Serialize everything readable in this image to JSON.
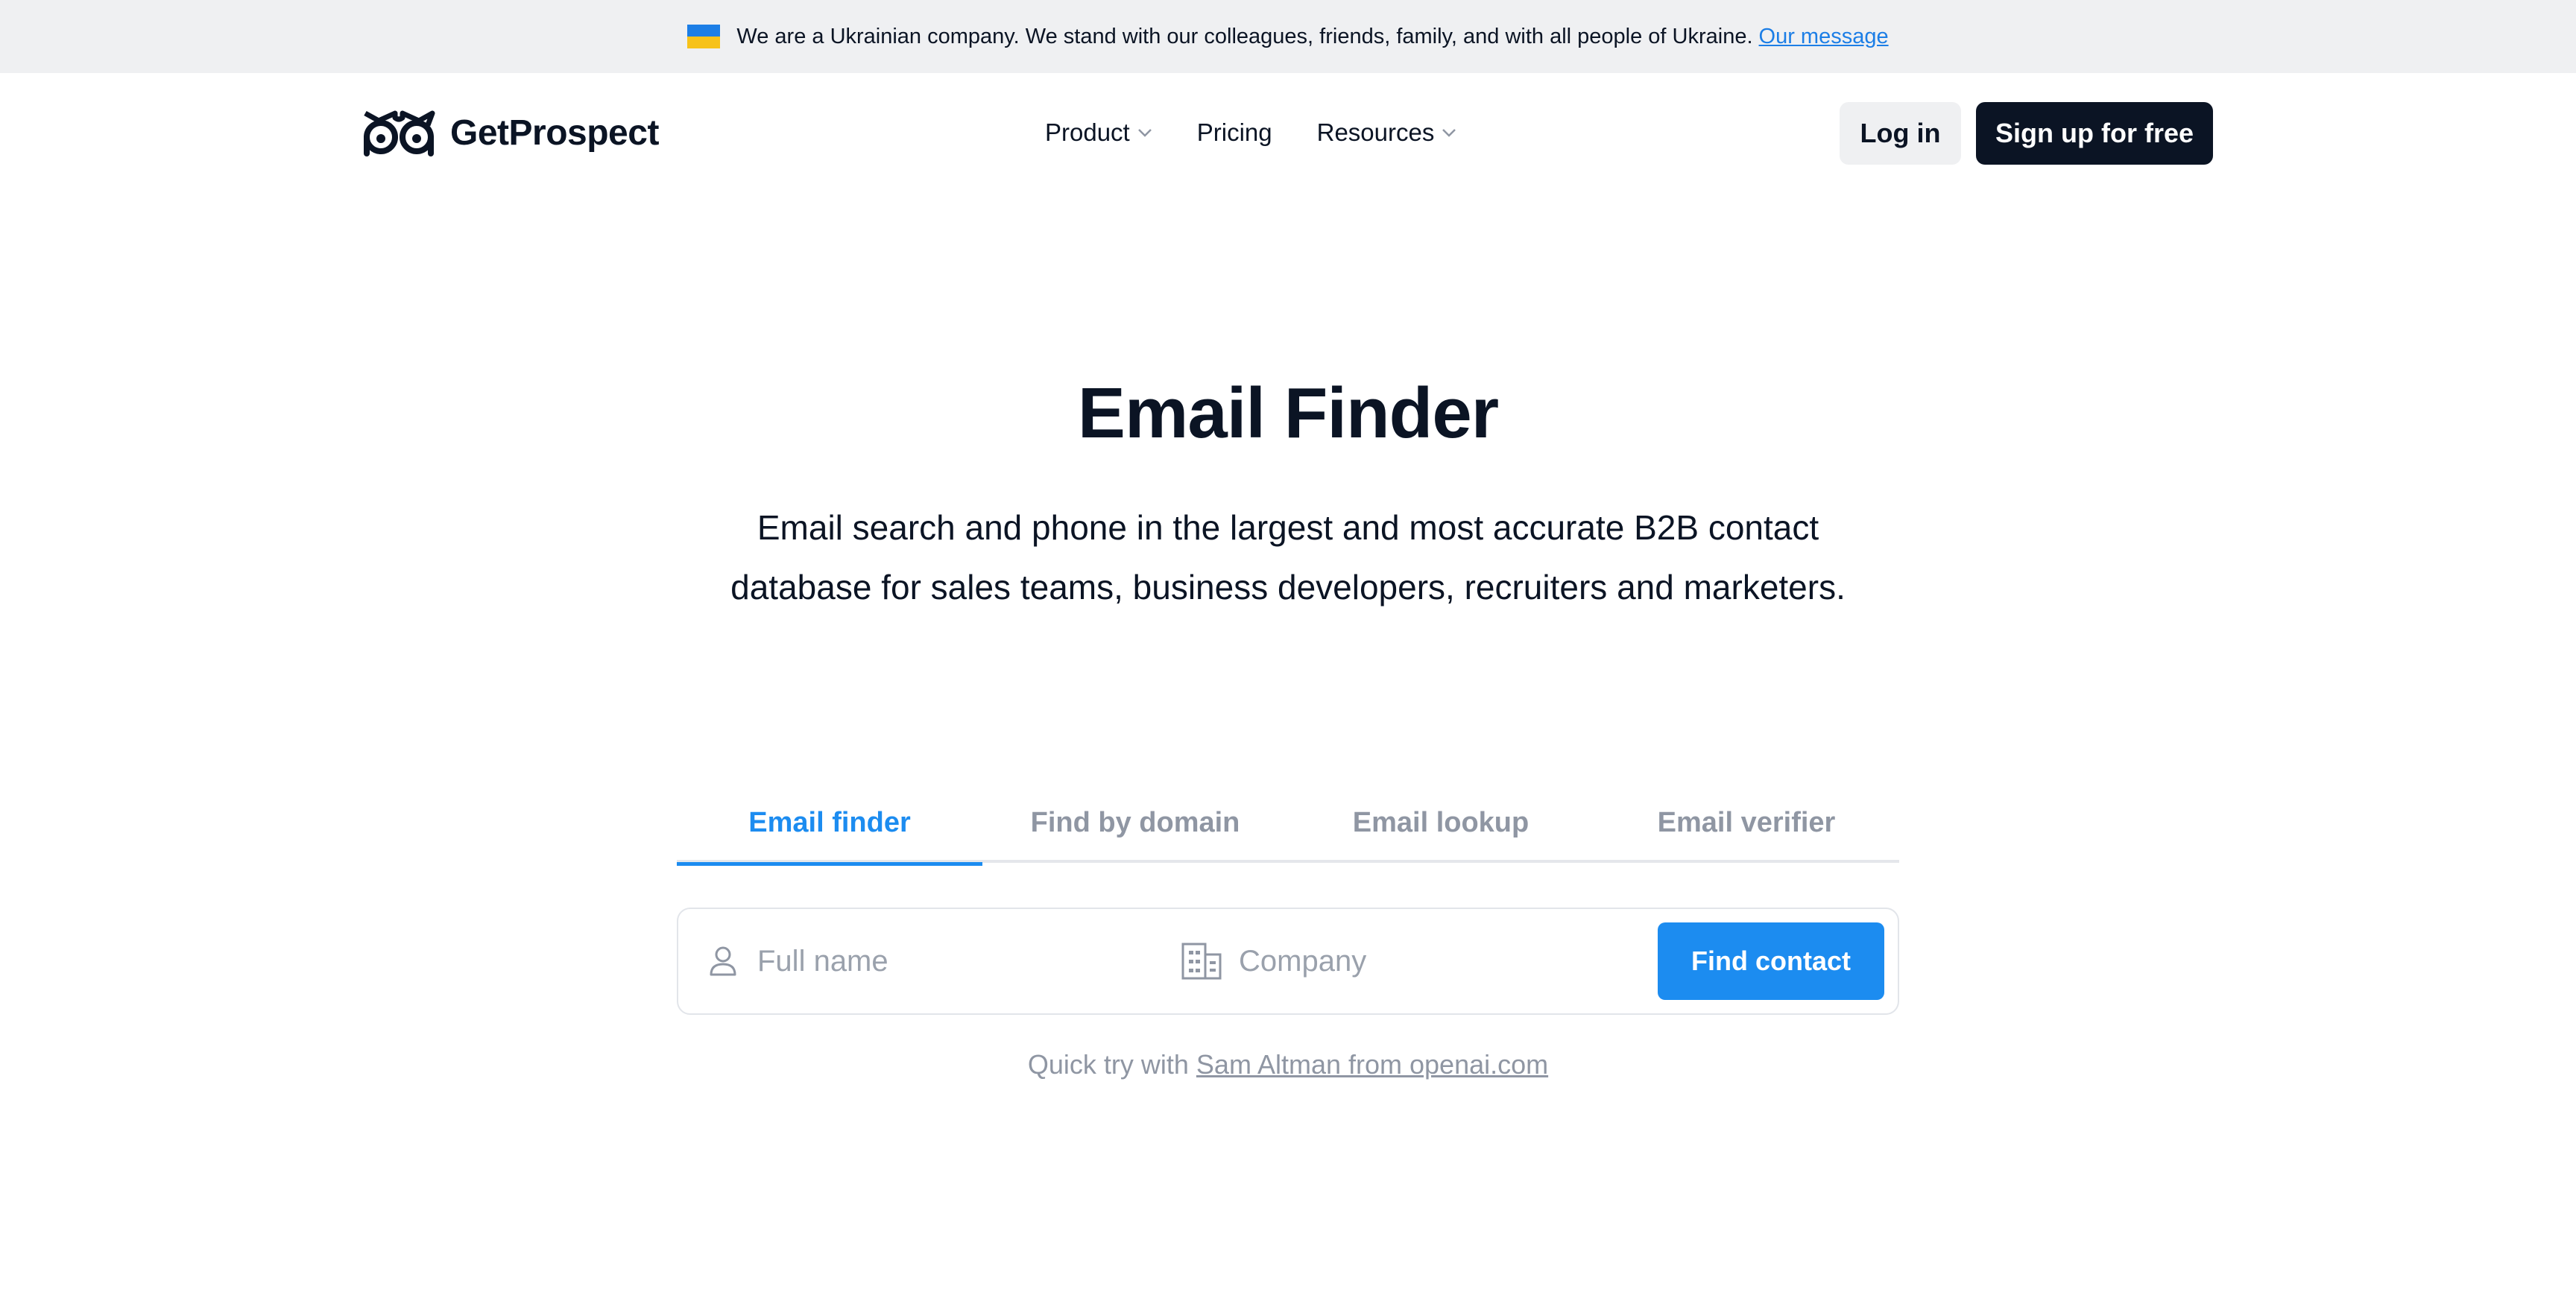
{
  "banner": {
    "text": "We are a Ukrainian company. We stand with our colleagues, friends, family, and with all people of Ukraine.",
    "link": "Our message",
    "flag_colors": [
      "#1c7ee6",
      "#f7c21a"
    ]
  },
  "header": {
    "logo_text": "GetProspect",
    "nav": [
      {
        "label": "Product",
        "has_dropdown": true
      },
      {
        "label": "Pricing",
        "has_dropdown": false
      },
      {
        "label": "Resources",
        "has_dropdown": true
      }
    ],
    "login_label": "Log in",
    "signup_label": "Sign up for free"
  },
  "hero": {
    "title": "Email Finder",
    "subtitle": "Email search and phone in the largest and most accurate B2B contact database for sales teams, business developers, recruiters and marketers."
  },
  "tabs": [
    {
      "label": "Email finder",
      "active": true
    },
    {
      "label": "Find by domain",
      "active": false
    },
    {
      "label": "Email lookup",
      "active": false
    },
    {
      "label": "Email verifier",
      "active": false
    }
  ],
  "search": {
    "name_placeholder": "Full name",
    "name_value": "",
    "company_placeholder": "Company",
    "company_value": "",
    "button_label": "Find contact"
  },
  "quick_try": {
    "prefix": "Quick try with",
    "link": "Sam Altman from openai.com"
  },
  "colors": {
    "accent": "#1c8cf0",
    "dark": "#0b1424",
    "muted": "#8f96a3"
  }
}
